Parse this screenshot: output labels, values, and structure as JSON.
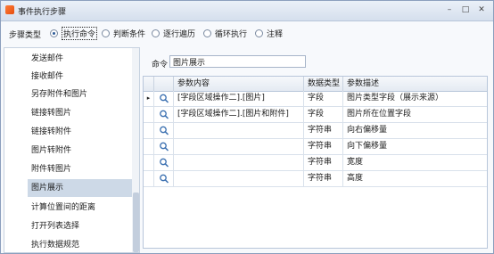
{
  "window": {
    "title": "事件执行步骤",
    "icon": "app-icon",
    "controls": [
      "minimize-icon",
      "maximize-icon",
      "close-icon"
    ]
  },
  "step_type": {
    "label": "步骤类型",
    "options": [
      {
        "label": "执行命令",
        "checked": true
      },
      {
        "label": "判断条件",
        "checked": false
      },
      {
        "label": "逐行遍历",
        "checked": false
      },
      {
        "label": "循环执行",
        "checked": false
      },
      {
        "label": "注释",
        "checked": false
      }
    ]
  },
  "command_list": {
    "items": [
      "发送邮件",
      "接收邮件",
      "另存附件和图片",
      "链接转图片",
      "链接转附件",
      "图片转附件",
      "附件转图片",
      "图片展示",
      "计算位置间的距离",
      "打开列表选择",
      "执行数据规范"
    ],
    "selected": "图片展示"
  },
  "command": {
    "label": "命令",
    "value": "图片展示"
  },
  "param_grid": {
    "columns": [
      "参数内容",
      "数据类型",
      "参数描述"
    ],
    "rows": [
      {
        "content": "[字段区域操作二].[图片]",
        "type": "字段",
        "description": "图片类型字段（展示来源）",
        "current": true
      },
      {
        "content": "[字段区域操作二].[图片和附件]",
        "type": "字段",
        "description": "图片所在位置字段",
        "current": false
      },
      {
        "content": "",
        "type": "字符串",
        "description": "向右偏移量",
        "current": false
      },
      {
        "content": "",
        "type": "字符串",
        "description": "向下偏移量",
        "current": false
      },
      {
        "content": "",
        "type": "字符串",
        "description": "宽度",
        "current": false
      },
      {
        "content": "",
        "type": "字符串",
        "description": "高度",
        "current": false
      }
    ],
    "row_button_icon": "search-icon",
    "current_row_marker": "▸"
  }
}
